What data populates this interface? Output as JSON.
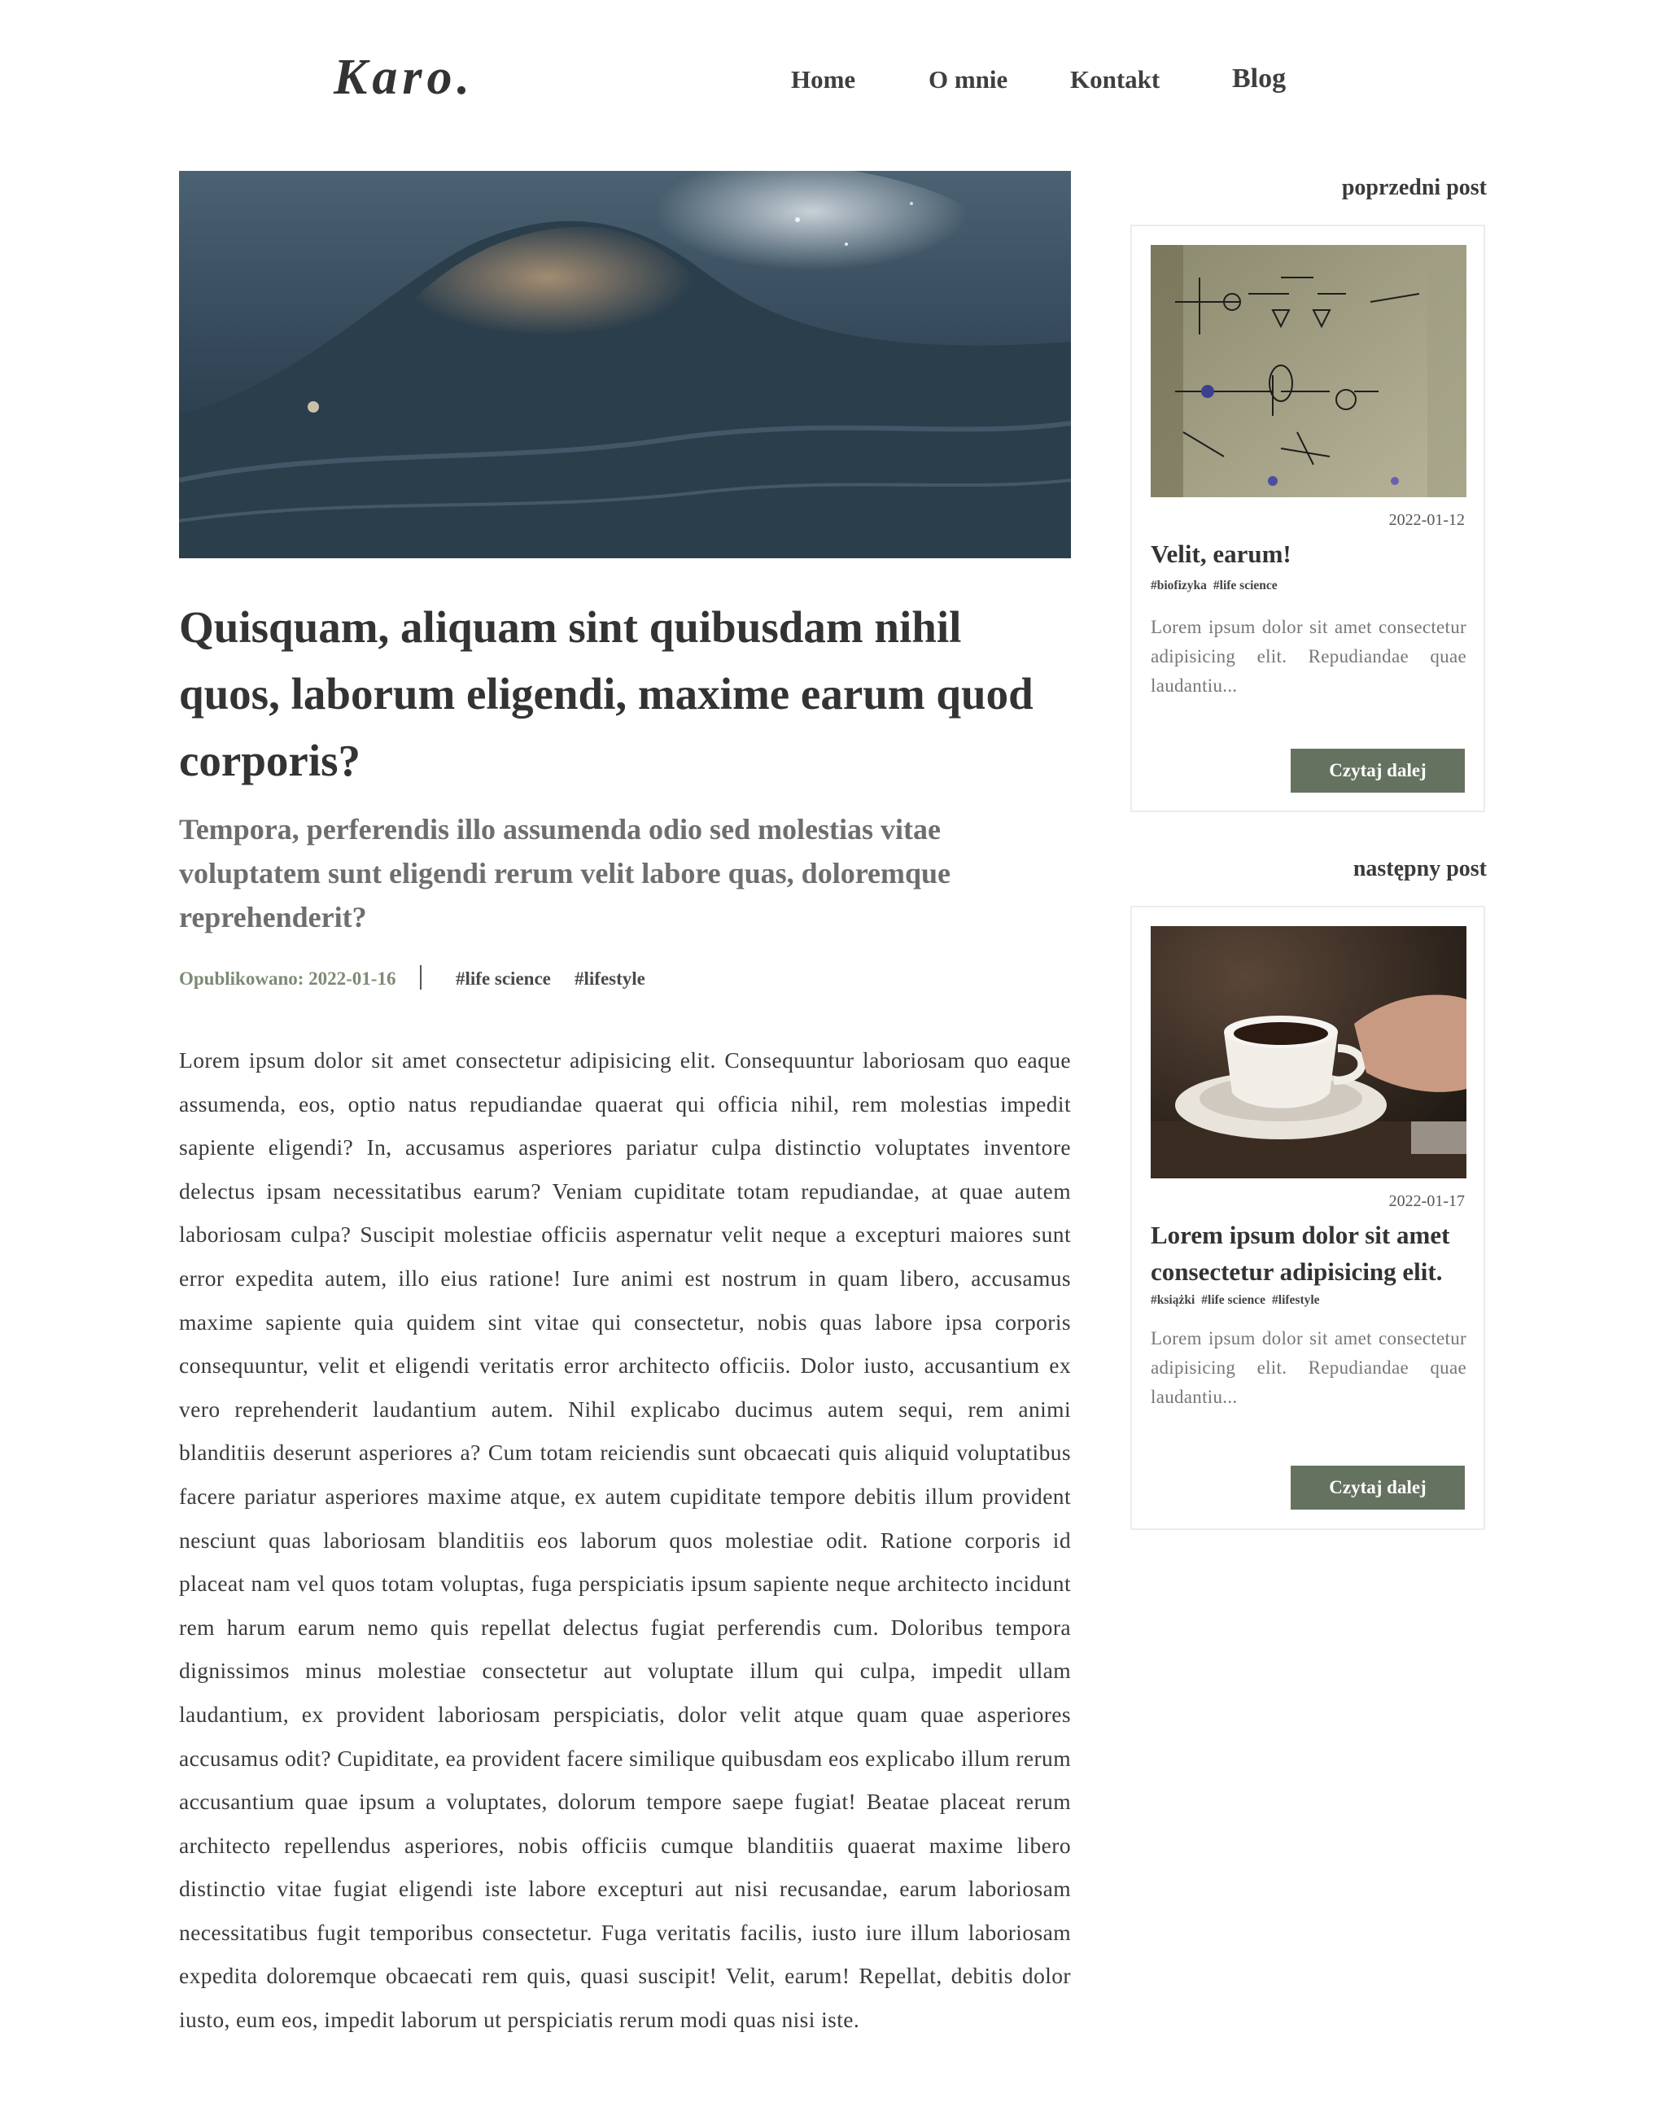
{
  "header": {
    "logo": "Karo.",
    "nav": [
      {
        "label": "Home"
      },
      {
        "label": "O mnie"
      },
      {
        "label": "Kontakt"
      },
      {
        "label": "Blog"
      }
    ]
  },
  "article": {
    "title": "Quisquam, aliquam sint quibusdam nihil quos, laborum eligendi, maxime earum quod corporis?",
    "subtitle": "Tempora, perferendis illo assumenda odio sed molestias vitae voluptatem sunt eligendi rerum velit labore quas, doloremque reprehenderit?",
    "published": "Opublikowano: 2022-01-16",
    "tags": [
      "#life science",
      "#lifestyle"
    ],
    "body": "Lorem ipsum dolor sit amet consectetur adipisicing elit. Consequuntur laboriosam quo eaque assumenda, eos, optio natus repudiandae quaerat qui officia nihil, rem molestias impedit sapiente eligendi? In, accusamus asperiores pariatur culpa distinctio voluptates inventore delectus ipsam necessitatibus earum? Veniam cupiditate totam repudiandae, at quae autem laboriosam culpa? Suscipit molestiae officiis aspernatur velit neque a excepturi maiores sunt error expedita autem, illo eius ratione! Iure animi est nostrum in quam libero, accusamus maxime sapiente quia quidem sint vitae qui consectetur, nobis quas labore ipsa corporis consequuntur, velit et eligendi veritatis error architecto officiis. Dolor iusto, accusantium ex vero reprehenderit laudantium autem. Nihil explicabo ducimus autem sequi, rem animi blanditiis deserunt asperiores a? Cum totam reiciendis sunt obcaecati quis aliquid voluptatibus facere pariatur asperiores maxime atque, ex autem cupiditate tempore debitis illum provident nesciunt quas laboriosam blanditiis eos laborum quos molestiae odit. Ratione corporis id placeat nam vel quos totam voluptas, fuga perspiciatis ipsum sapiente neque architecto incidunt rem harum earum nemo quis repellat delectus fugiat perferendis cum. Doloribus tempora dignissimos minus molestiae consectetur aut voluptate illum qui culpa, impedit ullam laudantium, ex provident laboriosam perspiciatis, dolor velit atque quam quae asperiores accusamus odit? Cupiditate, ea provident facere similique quibusdam eos explicabo illum rerum accusantium quae ipsum a voluptates, dolorum tempore saepe fugiat! Beatae placeat rerum architecto repellendus asperiores, nobis officiis cumque blanditiis quaerat maxime libero distinctio vitae fugiat eligendi iste labore excepturi aut nisi recusandae, earum laboriosam necessitatibus fugit temporibus consectetur. Fuga veritatis facilis, iusto iure illum laboriosam expedita doloremque obcaecati rem quis, quasi suscipit! Velit, earum! Repellat, debitis dolor iusto, eum eos, impedit laborum ut perspiciatis rerum modi quas nisi iste."
  },
  "sidebar": {
    "previous": {
      "heading": "poprzedni post",
      "date": "2022-01-12",
      "title": "Velit, earum!",
      "tags": [
        "#biofizyka",
        "#life science"
      ],
      "excerpt": "Lorem ipsum dolor sit amet consectetur adipisicing elit. Repudiandae quae laudantiu...",
      "button": "Czytaj dalej"
    },
    "next": {
      "heading": "następny post",
      "date": "2022-01-17",
      "title": "Lorem ipsum dolor sit amet consectetur adipisicing elit.",
      "tags": [
        "#książki",
        "#life science",
        "#lifestyle"
      ],
      "excerpt": "Lorem ipsum dolor sit amet consectetur adipisicing elit. Repudiandae quae laudantiu...",
      "button": "Czytaj dalej"
    }
  },
  "colors": {
    "accent": "#667260",
    "meta": "#7d8a74",
    "text": "#3a3a3a"
  }
}
